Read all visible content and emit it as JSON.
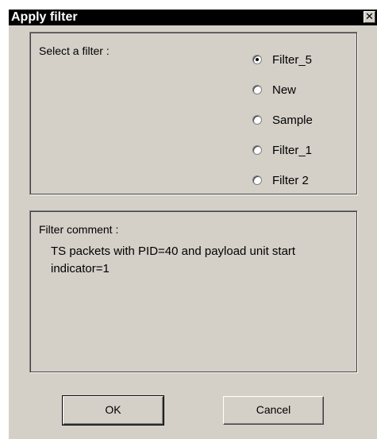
{
  "window": {
    "title": "Apply filter",
    "close_glyph": "✕",
    "close_icon": "close-icon"
  },
  "select_group": {
    "label": "Select a filter :",
    "options": [
      {
        "label": "Filter_5",
        "selected": true
      },
      {
        "label": "New",
        "selected": false
      },
      {
        "label": "Sample",
        "selected": false
      },
      {
        "label": "Filter_1",
        "selected": false
      },
      {
        "label": "Filter 2",
        "selected": false
      }
    ]
  },
  "comment_group": {
    "label": "Filter comment :",
    "text": "TS packets with PID=40 and payload unit start indicator=1"
  },
  "buttons": {
    "ok_label": "OK",
    "cancel_label": "Cancel"
  },
  "colors": {
    "dialog_bg": "#d4d0c8",
    "titlebar_bg": "#000000",
    "titlebar_text": "#ffffff"
  }
}
